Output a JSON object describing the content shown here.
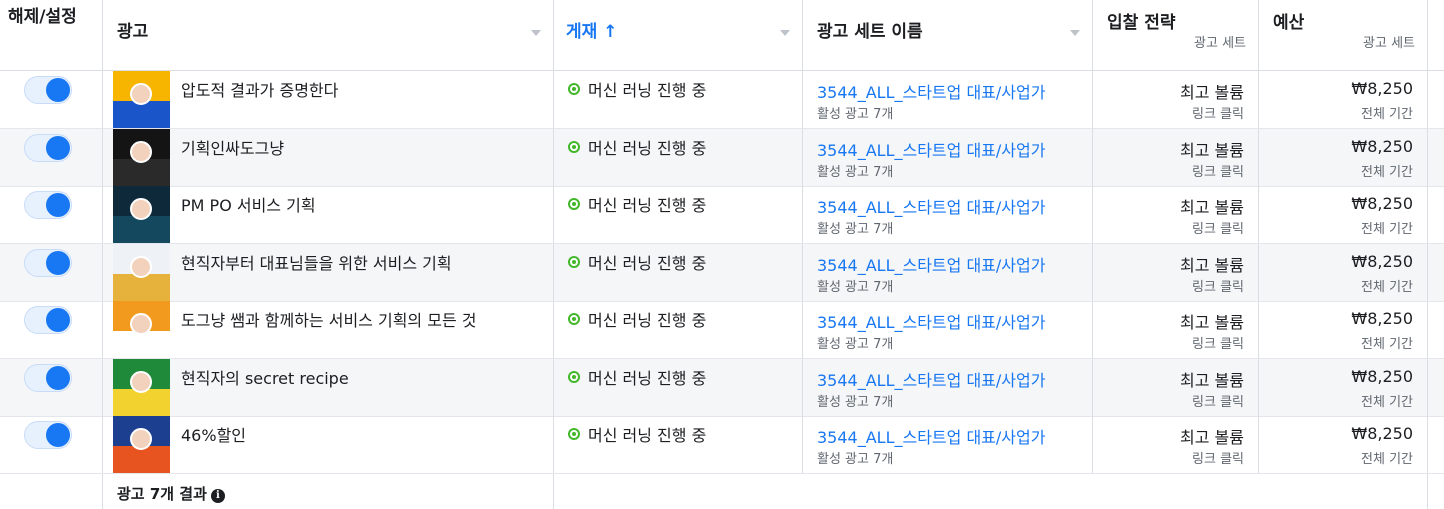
{
  "header": {
    "toggle_col": "해제/설정",
    "ad_col": "광고",
    "delivery_col": "게재 ↑",
    "adset_col": "광고 세트 이름",
    "bid_col": "입찰 전략",
    "bid_sub": "광고 세트",
    "budget_col": "예산",
    "budget_sub": "광고 세트"
  },
  "rows": [
    {
      "ad": "압도적 결과가 증명한다",
      "status": "머신 러닝 진행 중",
      "adset": "3544_ALL_스타트업 대표/사업가",
      "adset_sub": "활성 광고 7개",
      "bid": "최고 볼륨",
      "bid_sub": "링크 클릭",
      "budget": "₩8,250",
      "budget_sub": "전체 기간",
      "thumb_top": "#f7b500",
      "thumb_bot": "#1a56c9"
    },
    {
      "ad": "기획인싸도그냥",
      "status": "머신 러닝 진행 중",
      "adset": "3544_ALL_스타트업 대표/사업가",
      "adset_sub": "활성 광고 7개",
      "bid": "최고 볼륨",
      "bid_sub": "링크 클릭",
      "budget": "₩8,250",
      "budget_sub": "전체 기간",
      "thumb_top": "#141414",
      "thumb_bot": "#2a2a2a"
    },
    {
      "ad": "PM PO 서비스 기획",
      "status": "머신 러닝 진행 중",
      "adset": "3544_ALL_스타트업 대표/사업가",
      "adset_sub": "활성 광고 7개",
      "bid": "최고 볼륨",
      "bid_sub": "링크 클릭",
      "budget": "₩8,250",
      "budget_sub": "전체 기간",
      "thumb_top": "#0e2a3a",
      "thumb_bot": "#14485e"
    },
    {
      "ad": "현직자부터 대표님들을 위한 서비스 기획",
      "status": "머신 러닝 진행 중",
      "adset": "3544_ALL_스타트업 대표/사업가",
      "adset_sub": "활성 광고 7개",
      "bid": "최고 볼륨",
      "bid_sub": "링크 클릭",
      "budget": "₩8,250",
      "budget_sub": "전체 기간",
      "thumb_top": "#eef2f7",
      "thumb_bot": "#e6b23c"
    },
    {
      "ad": "도그냥 쌤과 함께하는 서비스 기획의 모든 것",
      "status": "머신 러닝 진행 중",
      "adset": "3544_ALL_스타트업 대표/사업가",
      "adset_sub": "활성 광고 7개",
      "bid": "최고 볼륨",
      "bid_sub": "링크 클릭",
      "budget": "₩8,250",
      "budget_sub": "전체 기간",
      "thumb_top": "#f29a1d",
      "thumb_bot": "#ffffff"
    },
    {
      "ad": "현직자의 secret recipe",
      "status": "머신 러닝 진행 중",
      "adset": "3544_ALL_스타트업 대표/사업가",
      "adset_sub": "활성 광고 7개",
      "bid": "최고 볼륨",
      "bid_sub": "링크 클릭",
      "budget": "₩8,250",
      "budget_sub": "전체 기간",
      "thumb_top": "#1f8a3a",
      "thumb_bot": "#f2d22e"
    },
    {
      "ad": "46%할인",
      "status": "머신 러닝 진행 중",
      "adset": "3544_ALL_스타트업 대표/사업가",
      "adset_sub": "활성 광고 7개",
      "bid": "최고 볼륨",
      "bid_sub": "링크 클릭",
      "budget": "₩8,250",
      "budget_sub": "전체 기간",
      "thumb_top": "#1d3f8f",
      "thumb_bot": "#e8541f"
    }
  ],
  "footer": {
    "summary": "광고 7개 결과"
  }
}
